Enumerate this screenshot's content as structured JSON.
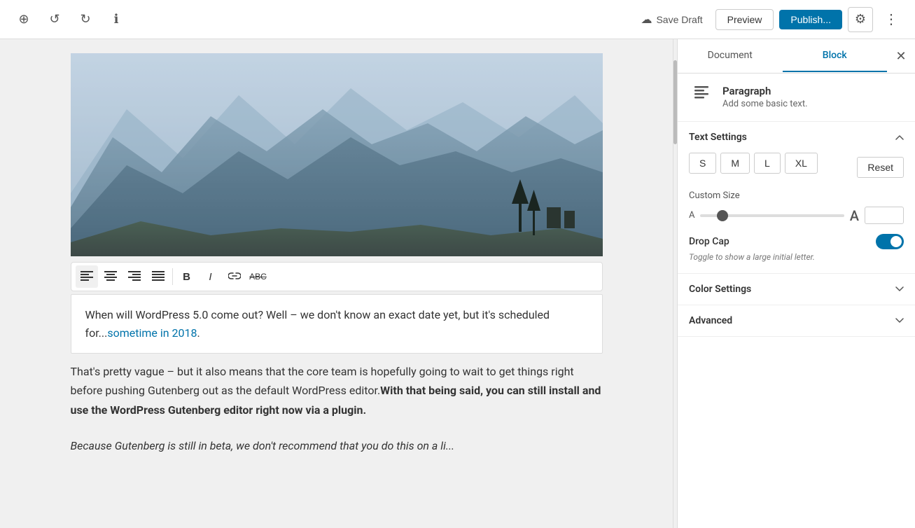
{
  "toolbar": {
    "add_label": "+",
    "undo_label": "↺",
    "redo_label": "↻",
    "info_label": "ℹ",
    "save_draft_label": "Save Draft",
    "preview_label": "Preview",
    "publish_label": "Publish...",
    "settings_label": "⚙",
    "more_label": "⋮"
  },
  "sidebar": {
    "document_tab": "Document",
    "block_tab": "Block",
    "close_label": "✕",
    "block_icon": "≡",
    "block_title": "Paragraph",
    "block_desc": "Add some basic text.",
    "text_settings": {
      "title": "Text Settings",
      "sizes": [
        "S",
        "M",
        "L",
        "XL"
      ],
      "reset_label": "Reset",
      "custom_size_label": "Custom Size",
      "slider_value": "",
      "drop_cap_label": "Drop Cap",
      "drop_cap_desc": "Toggle to show a large initial letter."
    },
    "color_settings": {
      "title": "Color Settings"
    },
    "advanced": {
      "title": "Advanced"
    }
  },
  "text_toolbar": {
    "align_left": "≡",
    "align_center": "≡",
    "align_right": "≡",
    "align_justify": "≡",
    "bold": "B",
    "italic": "I",
    "link": "🔗",
    "strikethrough": "ABC"
  },
  "content": {
    "paragraph1": "When will WordPress 5.0 come out? Well – we don't know an exact date yet, but it's scheduled for...",
    "link_text": "sometime in 2018",
    "link_suffix": ".",
    "paragraph2": "That's pretty vague – but it also means that the core team is hopefully going to wait to get things right before pushing Gutenberg out as the default WordPress editor.",
    "paragraph2_bold": "With that being said, you can still install and use the WordPress Gutenberg editor right now via a plugin.",
    "paragraph3": "Because Gutenberg is still in beta, we don't recommend that you do this on a li..."
  }
}
